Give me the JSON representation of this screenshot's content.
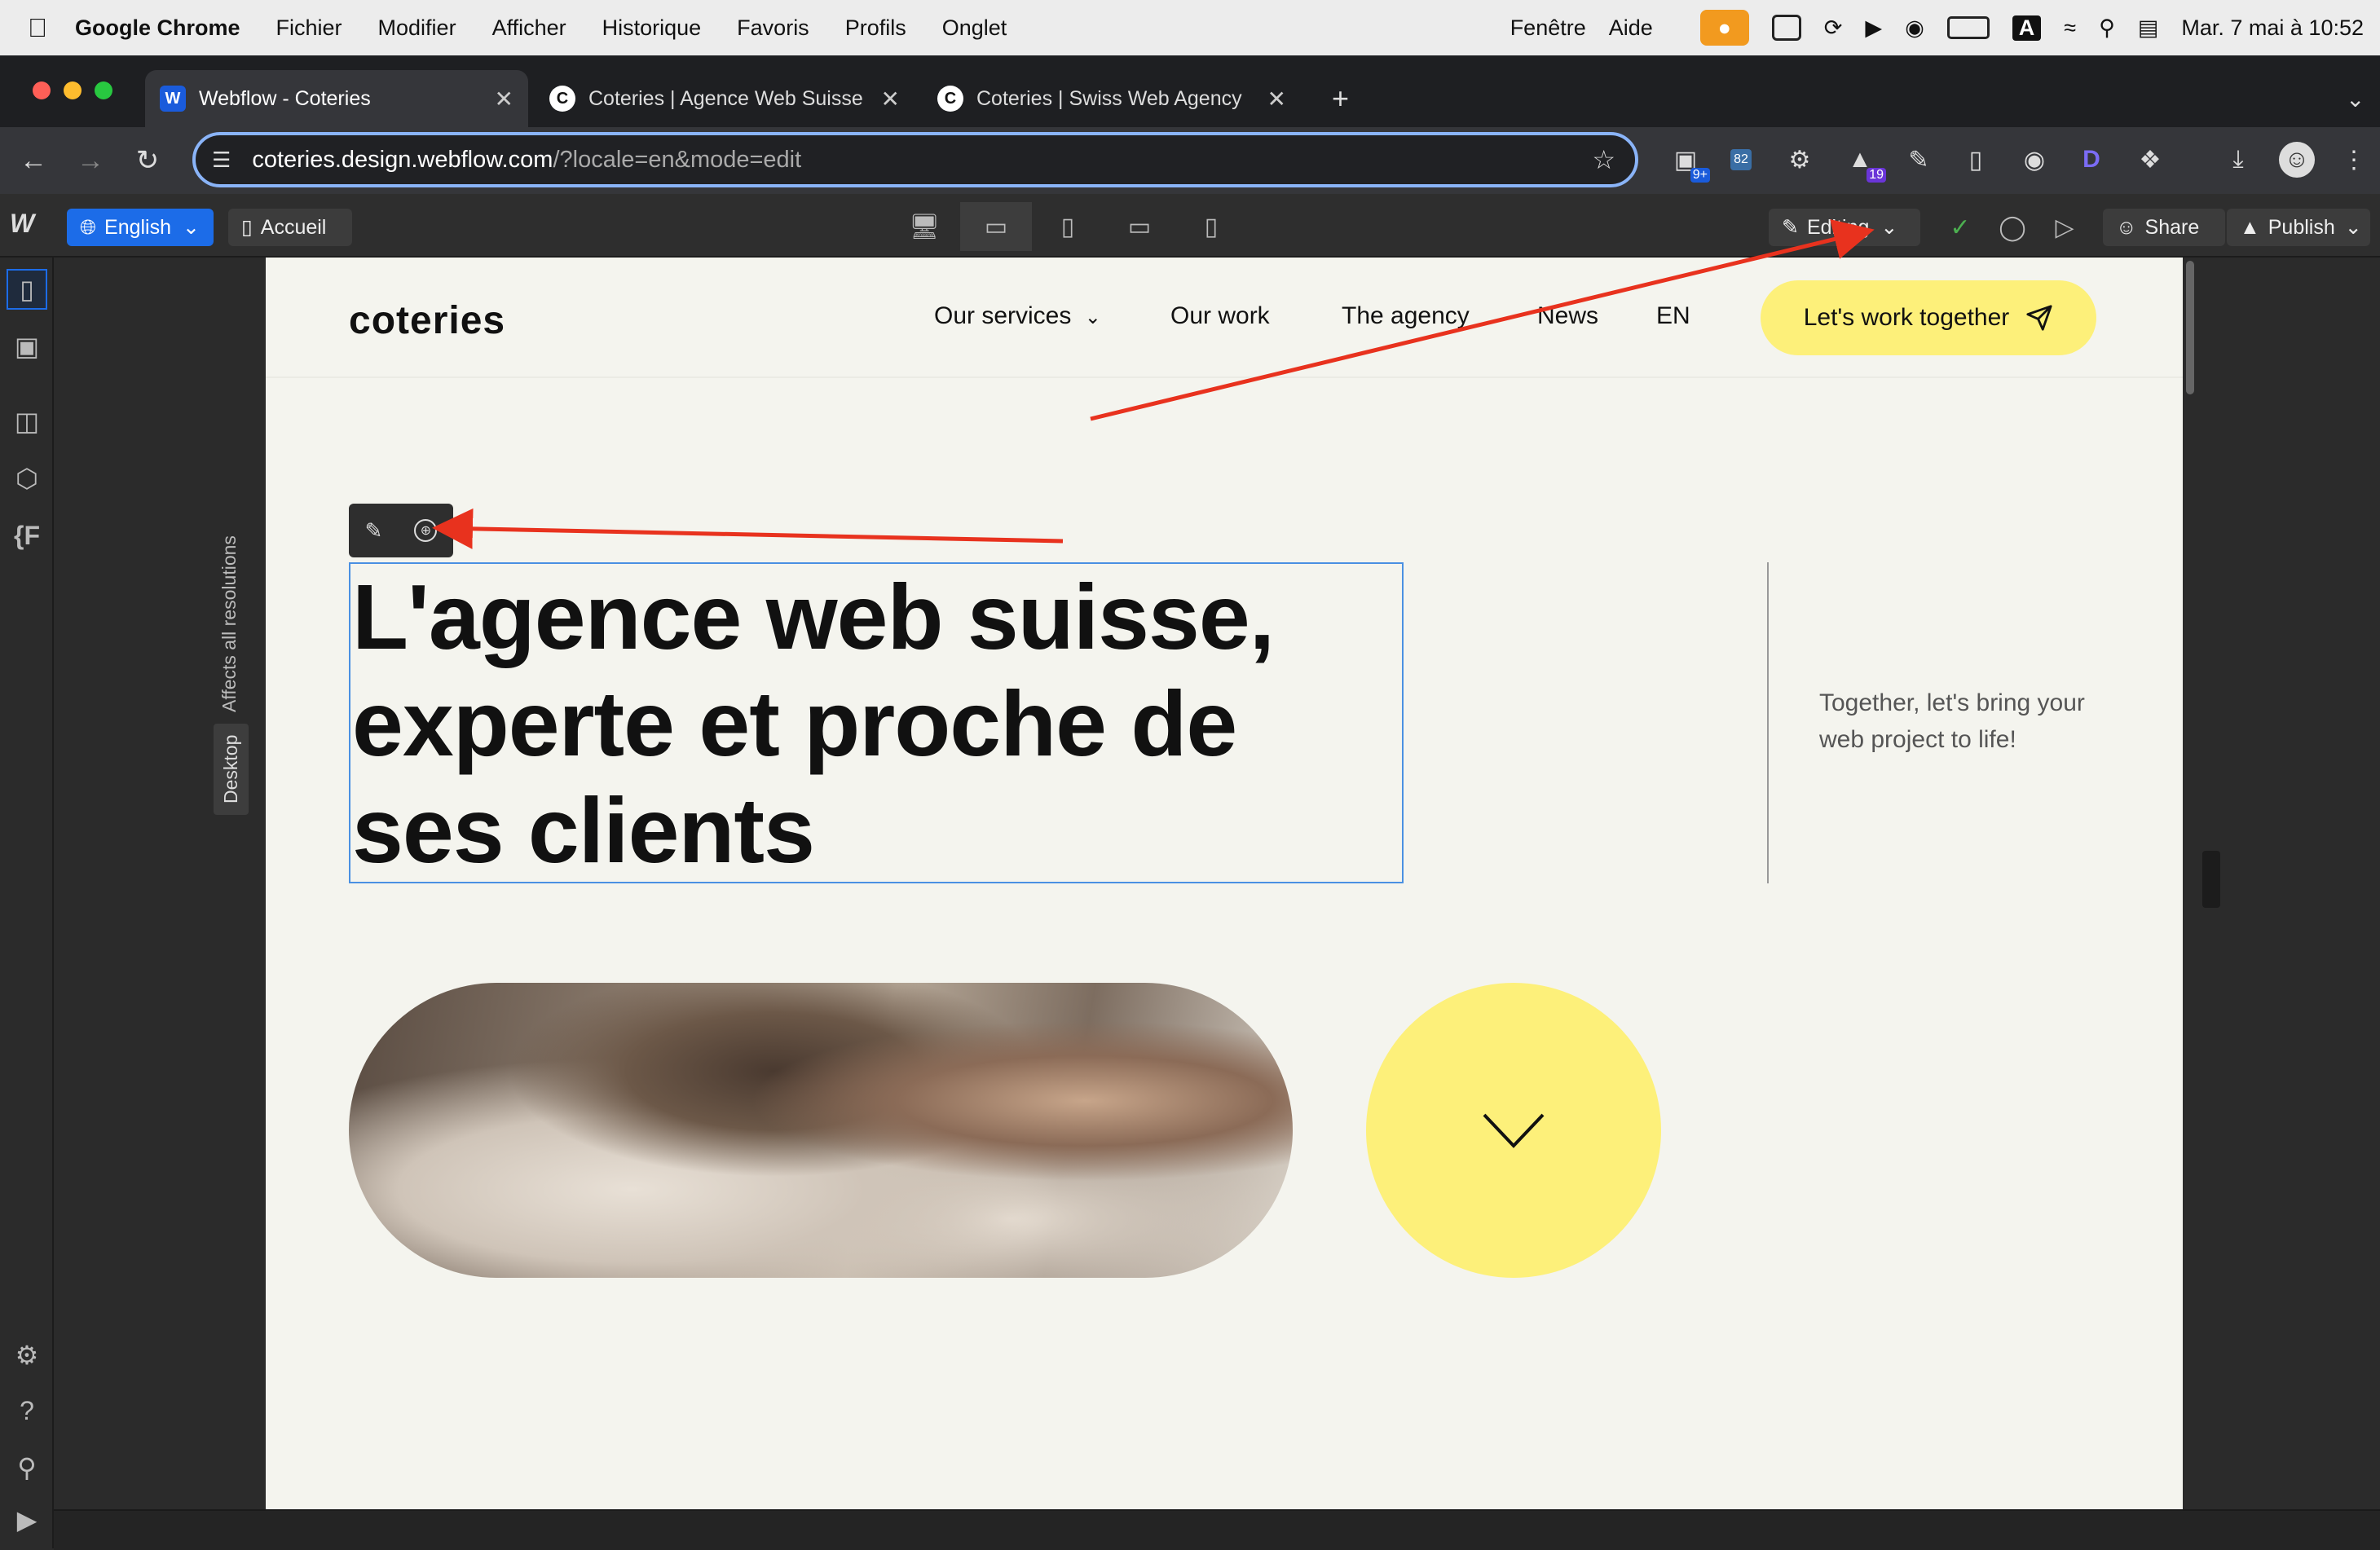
{
  "menubar": {
    "app": "Google Chrome",
    "items": [
      "Fichier",
      "Modifier",
      "Afficher",
      "Historique",
      "Favoris",
      "Profils",
      "Onglet"
    ],
    "right_items": [
      "Fenêtre",
      "Aide"
    ],
    "clock": "Mar. 7 mai à 10:52",
    "input_letter": "A"
  },
  "tabs": [
    {
      "title": "Webflow - Coteries",
      "icon": "webflow-icon"
    },
    {
      "title": "Coteries | Agence Web Suisse",
      "icon": "coteries-icon"
    },
    {
      "title": "Coteries | Swiss Web Agency",
      "icon": "coteries-icon"
    }
  ],
  "browser": {
    "url_host": "coteries.design.webflow.com",
    "url_path": "/?locale=en&mode=edit",
    "ext_badges": {
      "badge1": "9+",
      "badge2": "82",
      "badge3": "19"
    }
  },
  "webflow": {
    "locale_label": "English",
    "page_label": "Accueil",
    "mode_label": "Editing",
    "share_label": "Share",
    "publish_label": "Publish",
    "resolution_note": "Affects all resolutions",
    "breakpoint_tag": "Desktop"
  },
  "site": {
    "logo": "coteries",
    "nav": [
      "Our services",
      "Our work",
      "The agency",
      "News",
      "EN"
    ],
    "cta": "Let's work together",
    "hero_lines": [
      "L'agence web suisse,",
      "experte et proche de",
      "ses clients"
    ],
    "side_text_lines": [
      "Together, let's bring your",
      "web project to life!"
    ]
  },
  "colors": {
    "accent_yellow": "#fdf07a",
    "webflow_blue": "#1c6ce8",
    "annotation_red": "#e8321e",
    "canvas_bg": "#f4f4ee"
  }
}
